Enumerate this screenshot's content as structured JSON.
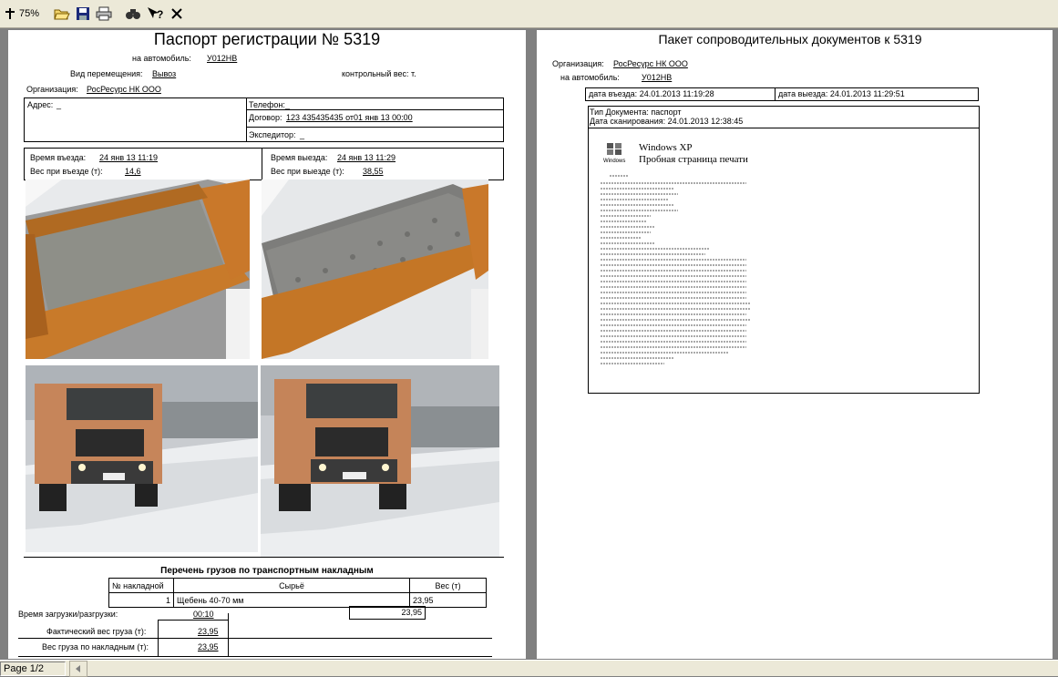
{
  "toolbar": {
    "zoom": "75%",
    "icons": [
      "zoom-icon",
      "open-folder-icon",
      "save-icon",
      "print-icon",
      "find-icon",
      "help-icon",
      "close-icon"
    ]
  },
  "left": {
    "title": "Паспорт регистрации № 5319",
    "vehicle_label": "на автомобиль:",
    "vehicle_value": "У012НВ",
    "move_label": "Вид перемещения:",
    "move_value": "Вывоз",
    "control_weight": "контрольный вес:  т.",
    "org_label": "Организация:",
    "org_value": "РосРесурс НК ООО",
    "address_label": "Адрес:",
    "address_value": "_",
    "phone_label": "Телефон:",
    "phone_value": "_",
    "contract_label": "Договор:",
    "contract_value": "123 435435435 от01 янв 13 00:00",
    "forwarder_label": "Экспедитор:",
    "forwarder_value": "_",
    "entry_time_label": "Время въезда:",
    "entry_time_value": "24 янв 13 11:19",
    "entry_weight_label": "Вес при въезде (т):",
    "entry_weight_value": "14,6",
    "exit_time_label": "Время выезда:",
    "exit_time_value": "24 янв 13 11:29",
    "exit_weight_label": "Вес при выезде (т):",
    "exit_weight_value": "38,55",
    "cargo_title": "Перечень грузов по транспортным накладным",
    "cargo_headers": [
      "№ накладной",
      "Сырьё",
      "Вес (т)"
    ],
    "cargo_rows": [
      {
        "num": "1",
        "material": "Щебень 40-70 мм",
        "weight": "23,95"
      }
    ],
    "cargo_total": "23,95",
    "load_time_label": "Время загрузки/разгрузки:",
    "load_time_value": "00:10",
    "actual_weight_label": "Фактический вес груза (т):",
    "actual_weight_value": "23,95",
    "invoice_weight_label": "Вес груза по накладным (т):",
    "invoice_weight_value": "23,95"
  },
  "right": {
    "title": "Пакет сопроводительных документов к 5319",
    "org_label": "Организация:",
    "org_value": "РосРесурс НК ООО",
    "vehicle_label": "на автомобиль:",
    "vehicle_value": "У012НВ",
    "entry_date": "дата въезда: 24.01.2013 11:19:28",
    "exit_date": "дата выезда: 24.01.2013 11:29:51",
    "doc_type": "Тип Документа: паспорт",
    "scan_date": "Дата сканирования: 24.01.2013 12:38:45",
    "scan_heading1": "Windows XP",
    "scan_heading2": "Пробная страница печати",
    "scan_logo": "Windows"
  },
  "status": {
    "page": "Page 1/2"
  }
}
